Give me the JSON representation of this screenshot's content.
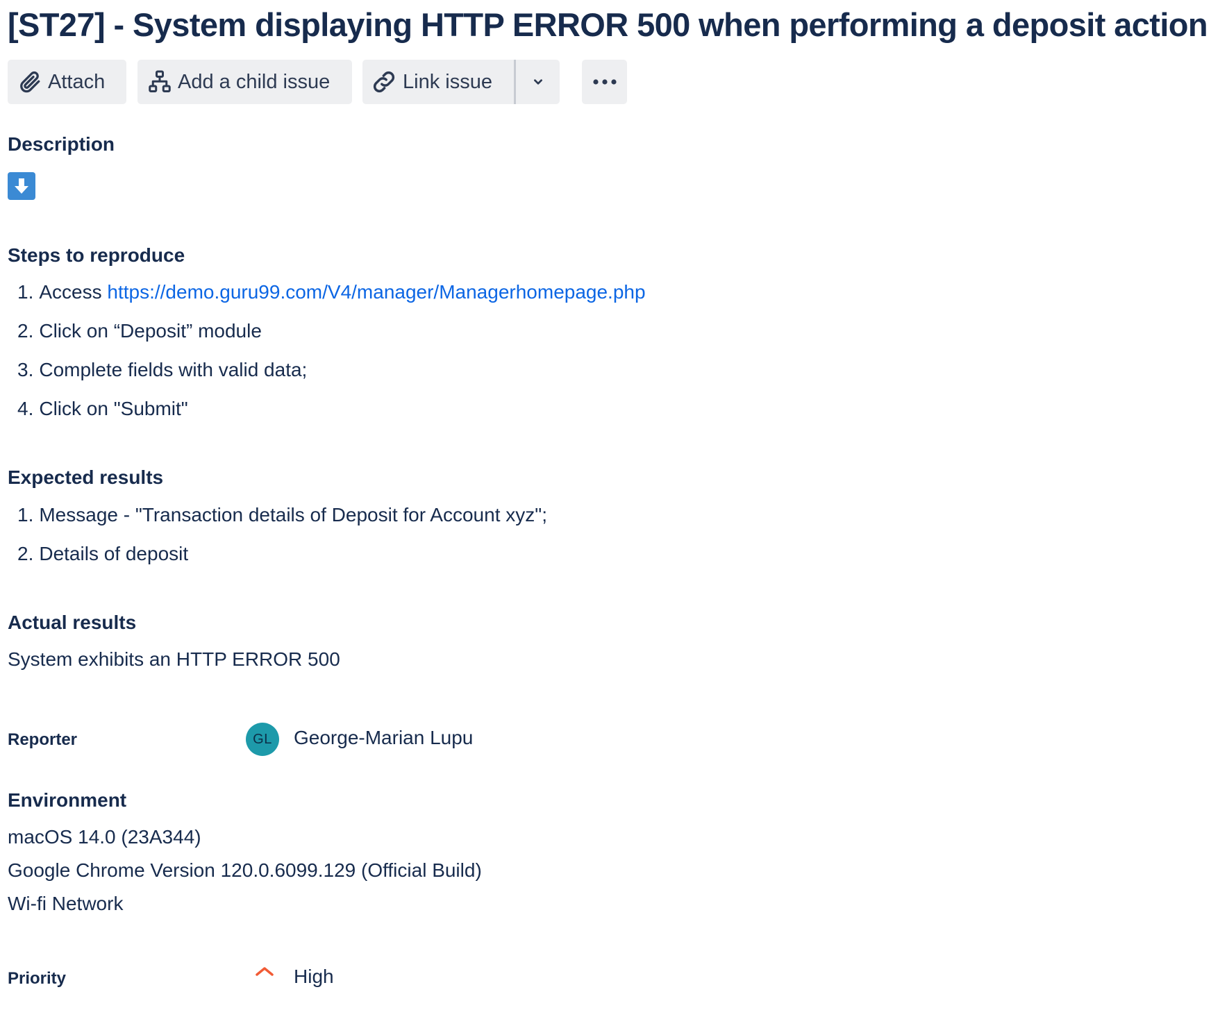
{
  "issue": {
    "title": "[ST27] - System displaying HTTP ERROR 500 when performing a deposit action"
  },
  "toolbar": {
    "attach_label": "Attach",
    "add_child_label": "Add a child issue",
    "link_issue_label": "Link issue",
    "icons": {
      "attach": "paperclip-icon",
      "add_child": "hierarchy-icon",
      "link_issue": "link-icon",
      "link_dropdown": "chevron-down-icon",
      "more": "more-horizontal-icon"
    }
  },
  "description": {
    "heading": "Description",
    "emoji": "arrow-down-emoji",
    "steps": {
      "heading": "Steps to reproduce",
      "items": [
        {
          "num": "1.",
          "text": "Access ",
          "link": "https://demo.guru99.com/V4/manager/Managerhomepage.php"
        },
        {
          "num": "2.",
          "text": "Click on “Deposit” module"
        },
        {
          "num": "3.",
          "text": "Complete fields with valid data;"
        },
        {
          "num": "4.",
          "text": "Click on \"Submit\""
        }
      ]
    },
    "expected": {
      "heading": "Expected results",
      "items": [
        {
          "num": "1.",
          "text": "Message - \"Transaction details of Deposit for Account xyz\";"
        },
        {
          "num": "2.",
          "text": "Details of deposit"
        }
      ]
    },
    "actual": {
      "heading": "Actual results",
      "text": "System exhibits an HTTP ERROR 500"
    }
  },
  "reporter": {
    "label": "Reporter",
    "initials": "GL",
    "name": "George-Marian Lupu",
    "avatar_color": "#1d9aaa"
  },
  "environment": {
    "heading": "Environment",
    "lines": [
      "macOS 14.0 (23A344)",
      "Google Chrome Version 120.0.6099.129 (Official Build)",
      "Wi-fi Network"
    ]
  },
  "priority": {
    "label": "Priority",
    "value": "High",
    "icon": "priority-high-icon",
    "icon_color": "#f15b35"
  },
  "colors": {
    "text": "#172b4d",
    "link": "#0c66e4",
    "button_bg": "#eeeff1"
  }
}
